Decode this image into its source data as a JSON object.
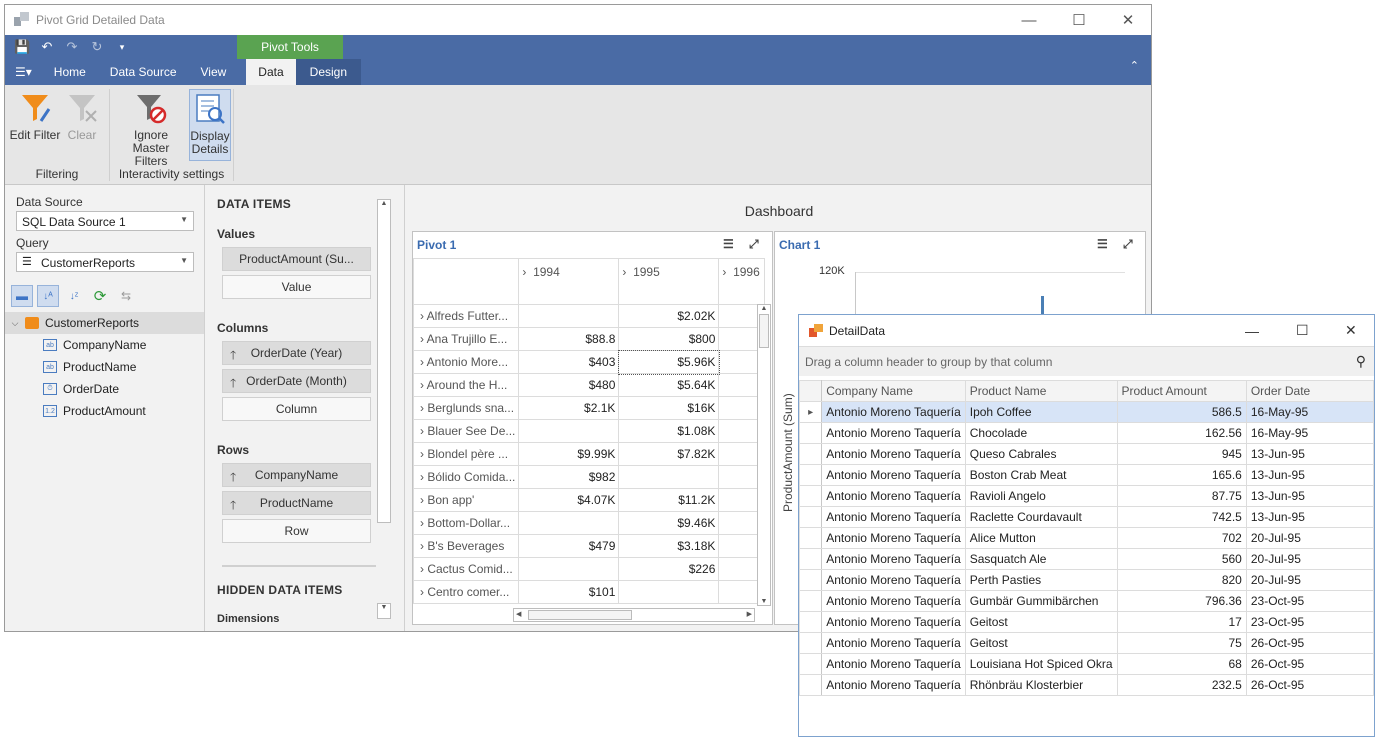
{
  "window": {
    "title": "Pivot Grid Detailed Data"
  },
  "ribbon": {
    "context_tab": "Pivot Tools",
    "tabs": [
      "Home",
      "Data Source",
      "View",
      "Data",
      "Design"
    ],
    "buttons": {
      "edit_filter": "Edit Filter",
      "clear": "Clear",
      "ignore_master_1": "Ignore Master",
      "ignore_master_2": "Filters",
      "display_details_1": "Display",
      "display_details_2": "Details"
    },
    "groups": {
      "filtering": "Filtering",
      "interactivity": "Interactivity settings"
    }
  },
  "left": {
    "data_source_label": "Data Source",
    "data_source_value": "SQL Data Source 1",
    "query_label": "Query",
    "query_value": "CustomerReports",
    "tree": {
      "root": "CustomerReports",
      "fields": [
        "CompanyName",
        "ProductName",
        "OrderDate",
        "ProductAmount"
      ],
      "field_icons": [
        "ab",
        "ab",
        "⏱",
        "1.2"
      ]
    }
  },
  "data_items": {
    "header": "DATA ITEMS",
    "values_label": "Values",
    "values": [
      "ProductAmount (Su...",
      "Value"
    ],
    "columns_label": "Columns",
    "columns": [
      "OrderDate (Year)",
      "OrderDate (Month)",
      "Column"
    ],
    "rows_label": "Rows",
    "rows": [
      "CompanyName",
      "ProductName",
      "Row"
    ],
    "hidden_header": "HIDDEN DATA ITEMS",
    "dimensions_label": "Dimensions"
  },
  "dashboard": {
    "title": "Dashboard",
    "pivot": {
      "caption": "Pivot 1",
      "col_headers": [
        "1994",
        "1995",
        "1996"
      ],
      "rows": [
        {
          "name": "Alfreds Futter...",
          "v1994": "",
          "v1995": "$2.02K"
        },
        {
          "name": "Ana Trujillo E...",
          "v1994": "$88.8",
          "v1995": "$800"
        },
        {
          "name": "Antonio More...",
          "v1994": "$403",
          "v1995": "$5.96K"
        },
        {
          "name": "Around the H...",
          "v1994": "$480",
          "v1995": "$5.64K"
        },
        {
          "name": "Berglunds sna...",
          "v1994": "$2.1K",
          "v1995": "$16K"
        },
        {
          "name": "Blauer See De...",
          "v1994": "",
          "v1995": "$1.08K"
        },
        {
          "name": "Blondel père ...",
          "v1994": "$9.99K",
          "v1995": "$7.82K"
        },
        {
          "name": "Bólido Comida...",
          "v1994": "$982",
          "v1995": ""
        },
        {
          "name": "Bon app'",
          "v1994": "$4.07K",
          "v1995": "$11.2K"
        },
        {
          "name": "Bottom-Dollar...",
          "v1994": "",
          "v1995": "$9.46K"
        },
        {
          "name": "B's Beverages",
          "v1994": "$479",
          "v1995": "$3.18K"
        },
        {
          "name": "Cactus Comid...",
          "v1994": "",
          "v1995": "$226"
        },
        {
          "name": "Centro comer...",
          "v1994": "$101",
          "v1995": ""
        }
      ]
    },
    "chart": {
      "caption": "Chart 1",
      "y_tick": "120K",
      "y_label_partial": "ProductAmount (Sum)"
    }
  },
  "detail": {
    "title": "DetailData",
    "group_hint": "Drag a column header to group by that column",
    "columns": [
      "Company Name",
      "Product Name",
      "Product Amount",
      "Order Date"
    ],
    "rows": [
      [
        "Antonio Moreno Taquería",
        "Ipoh Coffee",
        "586.5",
        "16-May-95"
      ],
      [
        "Antonio Moreno Taquería",
        "Chocolade",
        "162.56",
        "16-May-95"
      ],
      [
        "Antonio Moreno Taquería",
        "Queso Cabrales",
        "945",
        "13-Jun-95"
      ],
      [
        "Antonio Moreno Taquería",
        "Boston Crab Meat",
        "165.6",
        "13-Jun-95"
      ],
      [
        "Antonio Moreno Taquería",
        "Ravioli Angelo",
        "87.75",
        "13-Jun-95"
      ],
      [
        "Antonio Moreno Taquería",
        "Raclette Courdavault",
        "742.5",
        "13-Jun-95"
      ],
      [
        "Antonio Moreno Taquería",
        "Alice Mutton",
        "702",
        "20-Jul-95"
      ],
      [
        "Antonio Moreno Taquería",
        "Sasquatch Ale",
        "560",
        "20-Jul-95"
      ],
      [
        "Antonio Moreno Taquería",
        "Perth Pasties",
        "820",
        "20-Jul-95"
      ],
      [
        "Antonio Moreno Taquería",
        "Gumbär Gummibärchen",
        "796.36",
        "23-Oct-95"
      ],
      [
        "Antonio Moreno Taquería",
        "Geitost",
        "17",
        "23-Oct-95"
      ],
      [
        "Antonio Moreno Taquería",
        "Geitost",
        "75",
        "26-Oct-95"
      ],
      [
        "Antonio Moreno Taquería",
        "Louisiana Hot Spiced Okra",
        "68",
        "26-Oct-95"
      ],
      [
        "Antonio Moreno Taquería",
        "Rhönbräu Klosterbier",
        "232.5",
        "26-Oct-95"
      ]
    ]
  }
}
